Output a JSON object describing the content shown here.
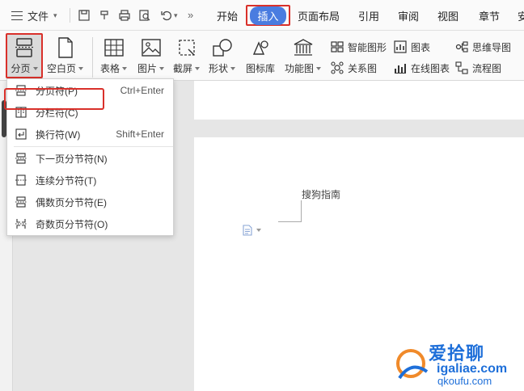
{
  "menubar": {
    "file_label": "文件",
    "tabs": [
      "开始",
      "插入",
      "页面布局",
      "引用",
      "审阅",
      "视图",
      "章节",
      "安"
    ],
    "active_tab": "插入",
    "more_glyph": "»"
  },
  "ribbon": {
    "page_break": "分页",
    "blank_page": "空白页",
    "table": "表格",
    "picture": "图片",
    "screenshot": "截屏",
    "shape": "形状",
    "icon_library": "图标库",
    "function_chart": "功能图",
    "smart_graphic": "智能图形",
    "relation_chart": "关系图",
    "chart": "图表",
    "online_chart": "在线图表",
    "mind_map": "思维导图",
    "flow_chart": "流程图"
  },
  "dropdown": {
    "items": [
      {
        "label": "分页符(P)",
        "shortcut": "Ctrl+Enter"
      },
      {
        "label": "分栏符(C)",
        "shortcut": ""
      },
      {
        "label": "换行符(W)",
        "shortcut": "Shift+Enter"
      },
      {
        "label": "下一页分节符(N)",
        "shortcut": ""
      },
      {
        "label": "连续分节符(T)",
        "shortcut": ""
      },
      {
        "label": "偶数页分节符(E)",
        "shortcut": ""
      },
      {
        "label": "奇数页分节符(O)",
        "shortcut": ""
      }
    ]
  },
  "document": {
    "text": "搜狗指南"
  },
  "watermark": {
    "title": "爱拾聊",
    "sub": "igaliae.com",
    "url": "qkoufu.com"
  },
  "colors": {
    "highlight_red": "#d9302a",
    "tab_blue": "#4a7ce0",
    "watermark_blue": "#1e6fd9"
  }
}
